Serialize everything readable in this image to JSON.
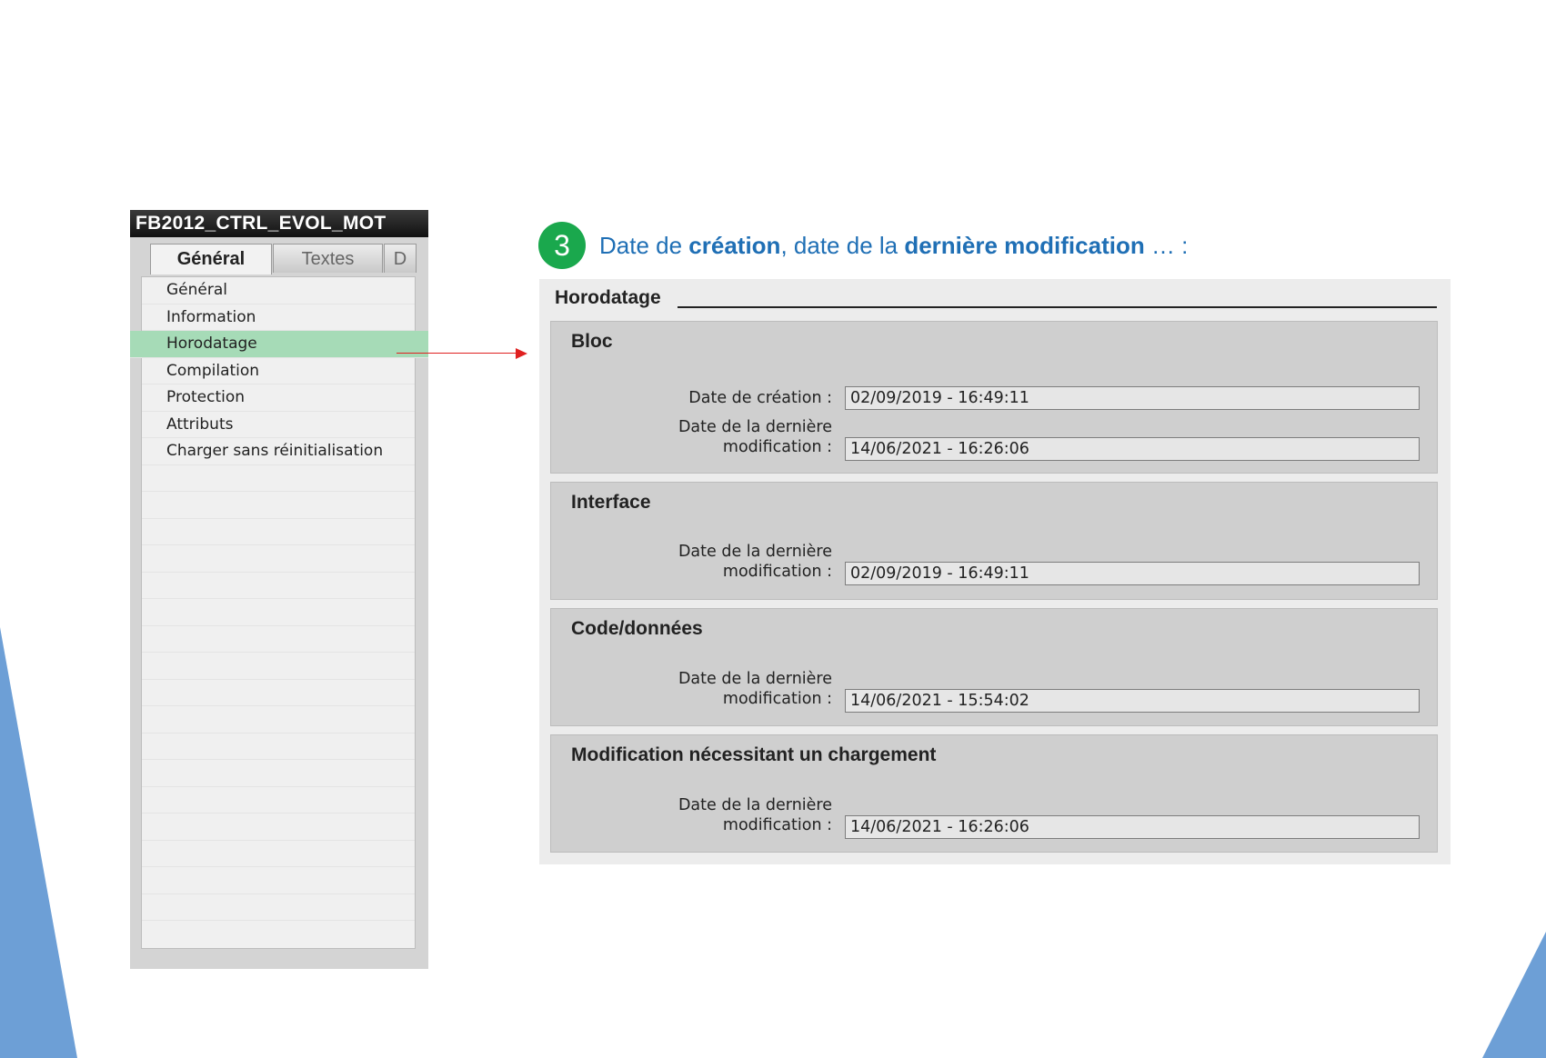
{
  "left_panel": {
    "title": "FB2012_CTRL_EVOL_MOT",
    "tabs": [
      "Général",
      "Textes",
      "D"
    ],
    "items": [
      "Général",
      "Information",
      "Horodatage",
      "Compilation",
      "Protection",
      "Attributs",
      "Charger sans réinitialisation"
    ],
    "selected_item": "Horodatage"
  },
  "heading": {
    "step": "3",
    "part1": "Date de ",
    "bold1": "création",
    "part2": ", date de la ",
    "bold2": "dernière modification",
    "part3": " … :"
  },
  "right_panel": {
    "title": "Horodatage",
    "sections": [
      {
        "title": "Bloc",
        "fields": [
          {
            "label_line1": "Date de création :",
            "label_line2": "",
            "value": "02/09/2019 - 16:49:11"
          },
          {
            "label_line1": "Date de la dernière",
            "label_line2": "modification :",
            "value": "14/06/2021 - 16:26:06"
          }
        ]
      },
      {
        "title": "Interface",
        "fields": [
          {
            "label_line1": "Date de la dernière",
            "label_line2": "modification :",
            "value": "02/09/2019 - 16:49:11"
          }
        ]
      },
      {
        "title": "Code/données",
        "fields": [
          {
            "label_line1": "Date de la dernière",
            "label_line2": "modification :",
            "value": "14/06/2021 - 15:54:02"
          }
        ]
      },
      {
        "title": "Modification nécessitant un chargement",
        "fields": [
          {
            "label_line1": "Date de la dernière",
            "label_line2": "modification :",
            "value": "14/06/2021 - 16:26:06"
          }
        ]
      }
    ]
  },
  "colors": {
    "selected_row": "#a6dbb7",
    "accent_blue": "#1f6fb5",
    "badge_green": "#1aa84d",
    "arrow_red": "#e02020"
  }
}
